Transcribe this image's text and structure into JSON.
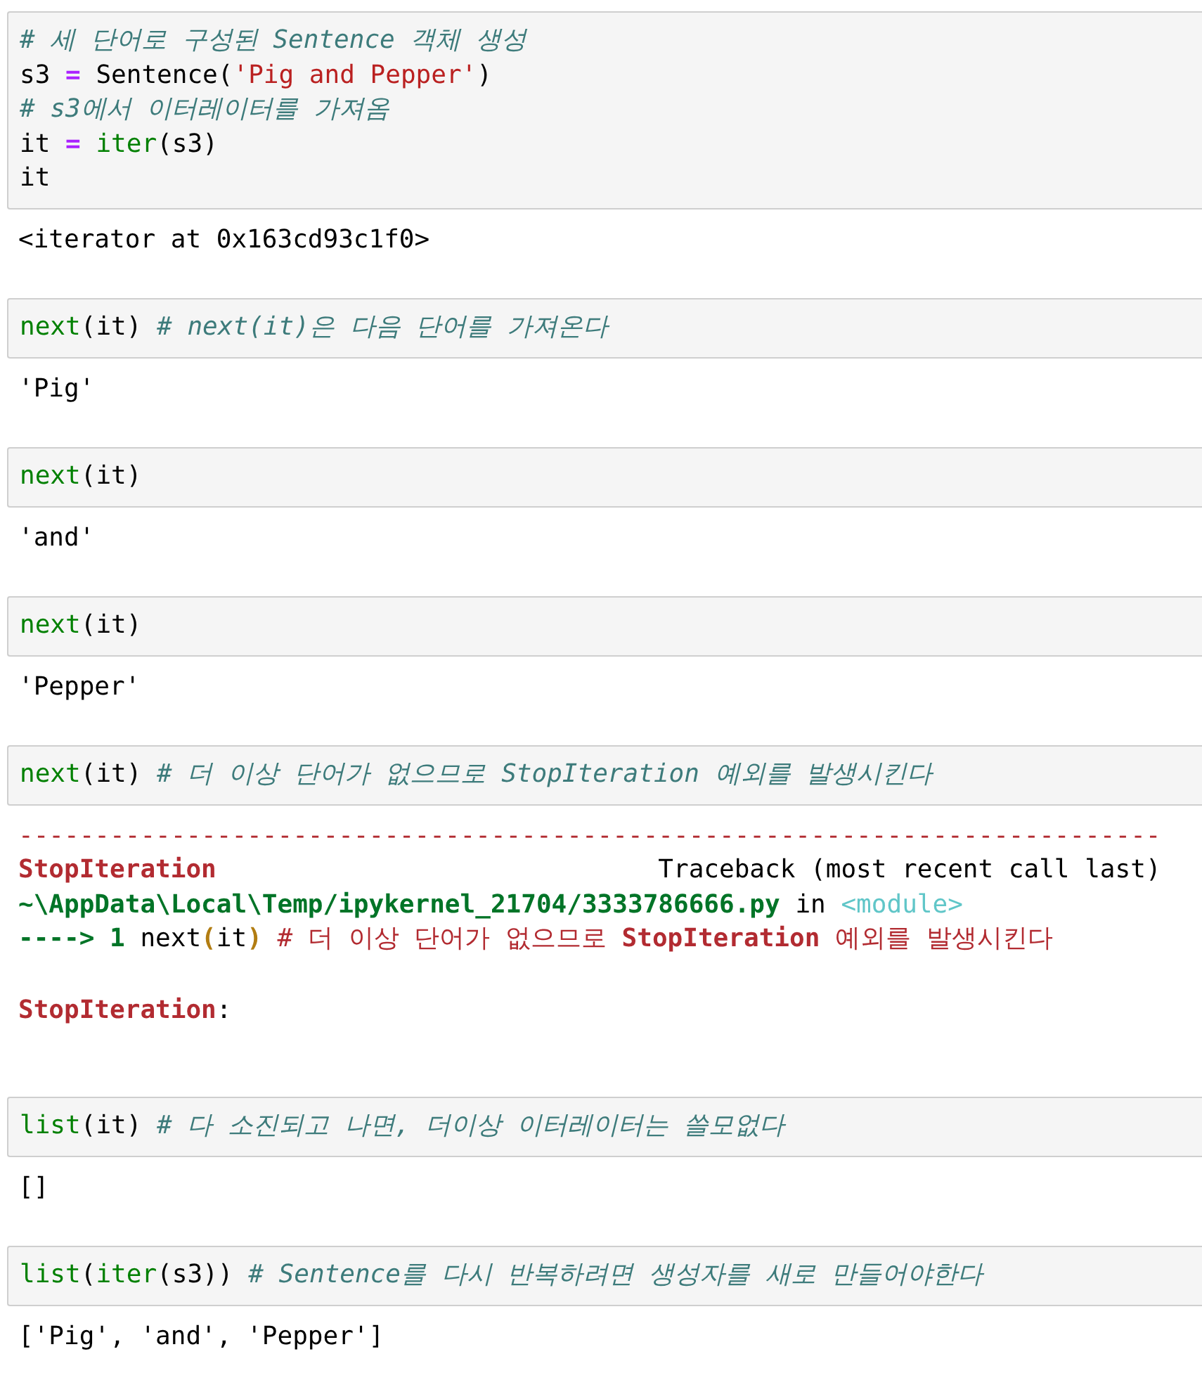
{
  "cells": [
    {
      "input": [
        [
          {
            "text": "# 세 단어로 구성된 Sentence 객체 생성",
            "kind": "comment"
          }
        ],
        [
          {
            "text": "s3 ",
            "kind": "plain"
          },
          {
            "text": "=",
            "kind": "op"
          },
          {
            "text": " Sentence(",
            "kind": "plain"
          },
          {
            "text": "'Pig and Pepper'",
            "kind": "string"
          },
          {
            "text": ")",
            "kind": "plain"
          }
        ],
        [
          {
            "text": "# s3에서 이터레이터를 가져옴",
            "kind": "comment"
          }
        ],
        [
          {
            "text": "it ",
            "kind": "plain"
          },
          {
            "text": "= ",
            "kind": "op"
          },
          {
            "text": "iter",
            "kind": "builtin"
          },
          {
            "text": "(s3)",
            "kind": "plain"
          }
        ],
        [
          {
            "text": "it",
            "kind": "plain"
          }
        ]
      ],
      "output": {
        "kind": "result",
        "paragraphs": [
          [
            [
              {
                "text": "<iterator at 0x163cd93c1f0>",
                "kind": "plain"
              }
            ]
          ]
        ]
      }
    },
    {
      "input": [
        [
          {
            "text": "next",
            "kind": "builtin"
          },
          {
            "text": "(it) ",
            "kind": "plain"
          },
          {
            "text": "# next(it)은 다음 단어를 가져온다",
            "kind": "comment"
          }
        ]
      ],
      "output": {
        "kind": "result",
        "paragraphs": [
          [
            [
              {
                "text": "'Pig'",
                "kind": "plain"
              }
            ]
          ]
        ]
      }
    },
    {
      "input": [
        [
          {
            "text": "next",
            "kind": "builtin"
          },
          {
            "text": "(it)",
            "kind": "plain"
          }
        ]
      ],
      "output": {
        "kind": "result",
        "paragraphs": [
          [
            [
              {
                "text": "'and'",
                "kind": "plain"
              }
            ]
          ]
        ]
      }
    },
    {
      "input": [
        [
          {
            "text": "next",
            "kind": "builtin"
          },
          {
            "text": "(it)",
            "kind": "plain"
          }
        ]
      ],
      "output": {
        "kind": "result",
        "paragraphs": [
          [
            [
              {
                "text": "'Pepper'",
                "kind": "plain"
              }
            ]
          ]
        ]
      }
    },
    {
      "input": [
        [
          {
            "text": "next",
            "kind": "builtin"
          },
          {
            "text": "(it) ",
            "kind": "plain"
          },
          {
            "text": "# 더 이상 단어가 없으므로 StopIteration 예외를 발생시킨다",
            "kind": "comment"
          }
        ]
      ],
      "output": {
        "kind": "error",
        "paragraphs": [
          [
            [
              {
                "text": "---------------------------------------------------------------------------",
                "kind": "err"
              }
            ],
            [
              {
                "text": "StopIteration",
                "kind": "err-bold"
              },
              {
                "text": "                             Traceback (most recent call last)",
                "kind": "plain"
              }
            ],
            [
              {
                "text": "~\\AppData\\Local\\Temp/ipykernel_21704/3333786666.py",
                "kind": "path"
              },
              {
                "text": " in ",
                "kind": "plain"
              },
              {
                "text": "<module>",
                "kind": "module"
              }
            ],
            [
              {
                "text": "----> 1",
                "kind": "path"
              },
              {
                "text": " next",
                "kind": "plain"
              },
              {
                "text": "(",
                "kind": "paren"
              },
              {
                "text": "it",
                "kind": "plain"
              },
              {
                "text": ")",
                "kind": "paren"
              },
              {
                "text": " # 더 이상 단어가 없으므로 ",
                "kind": "err"
              },
              {
                "text": "StopIteration",
                "kind": "err-bold"
              },
              {
                "text": " 예외를 발생시킨다",
                "kind": "err"
              }
            ]
          ],
          [
            [
              {
                "text": "StopIteration",
                "kind": "err-bold"
              },
              {
                "text": ":",
                "kind": "plain"
              }
            ]
          ]
        ]
      }
    },
    {
      "input": [
        [
          {
            "text": "list",
            "kind": "builtin"
          },
          {
            "text": "(it) ",
            "kind": "plain"
          },
          {
            "text": "# 다 소진되고 나면, 더이상 이터레이터는 쓸모없다",
            "kind": "comment"
          }
        ]
      ],
      "output": {
        "kind": "result",
        "paragraphs": [
          [
            [
              {
                "text": "[]",
                "kind": "plain"
              }
            ]
          ]
        ]
      }
    },
    {
      "input": [
        [
          {
            "text": "list",
            "kind": "builtin"
          },
          {
            "text": "(",
            "kind": "plain"
          },
          {
            "text": "iter",
            "kind": "builtin"
          },
          {
            "text": "(s3)) ",
            "kind": "plain"
          },
          {
            "text": "# Sentence를 다시 반복하려면 생성자를 새로 만들어야한다",
            "kind": "comment"
          }
        ]
      ],
      "output": {
        "kind": "result",
        "paragraphs": [
          [
            [
              {
                "text": "['Pig', 'and', 'Pepper']",
                "kind": "plain"
              }
            ]
          ]
        ]
      }
    }
  ]
}
